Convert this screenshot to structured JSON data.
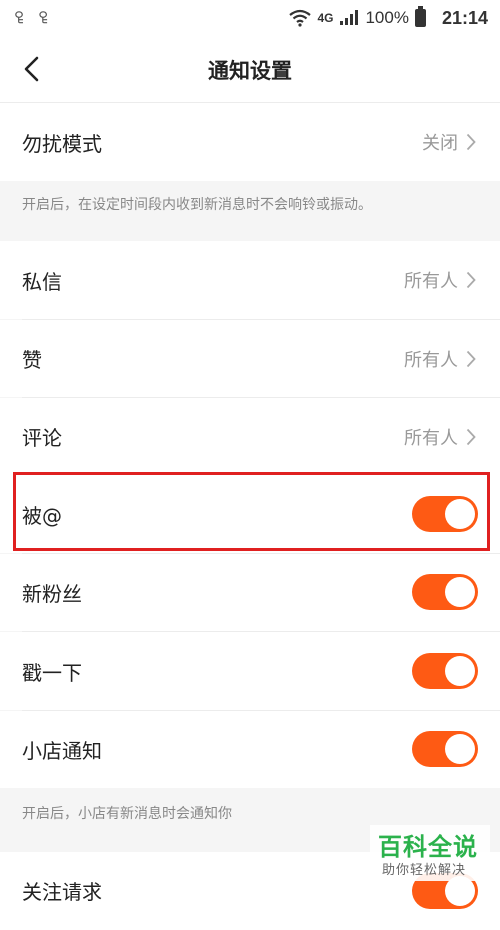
{
  "status_bar": {
    "left_icons": [
      "notification-icon",
      "notification-icon"
    ],
    "left_glyphs": [
      "ꄗ",
      "ꄗ"
    ],
    "network": "4G",
    "battery_percent": "100%",
    "time": "21:14"
  },
  "header": {
    "title": "通知设置"
  },
  "dnd": {
    "label": "勿扰模式",
    "value": "关闭",
    "hint": "开启后，在设定时间段内收到新消息时不会响铃或振动。"
  },
  "privacy": {
    "items": [
      {
        "label": "私信",
        "value": "所有人"
      },
      {
        "label": "赞",
        "value": "所有人"
      },
      {
        "label": "评论",
        "value": "所有人"
      }
    ]
  },
  "toggles": {
    "items": [
      {
        "label": "被@",
        "on": true
      },
      {
        "label": "新粉丝",
        "on": true
      },
      {
        "label": "戳一下",
        "on": true
      },
      {
        "label": "小店通知",
        "on": true
      }
    ],
    "hint": "开启后，小店有新消息时会通知你"
  },
  "follow_request": {
    "label": "关注请求",
    "on": true
  },
  "watermark": {
    "title": "百科全说",
    "subtitle": "助你轻松解决"
  },
  "colors": {
    "accent": "#fe5a14",
    "highlight": "#e02020",
    "watermark": "#2bb24c"
  }
}
